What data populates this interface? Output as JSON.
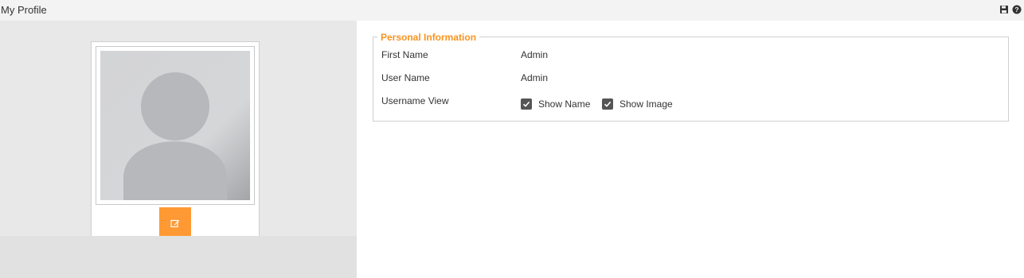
{
  "header": {
    "title": "My Profile",
    "icons": [
      "save-icon",
      "help-icon"
    ]
  },
  "profile_photo": {
    "edit_icon": "edit-icon",
    "placeholder_icon": "user-silhouette-icon"
  },
  "personal_information": {
    "legend": "Personal Information",
    "first_name": {
      "label": "First Name",
      "value": "Admin"
    },
    "user_name": {
      "label": "User Name",
      "value": "Admin"
    },
    "username_view": {
      "label": "Username View",
      "show_name": {
        "label": "Show Name",
        "checked": true
      },
      "show_image": {
        "label": "Show Image",
        "checked": true
      }
    }
  },
  "colors": {
    "accent": "#ff9933",
    "legend": "#f7931e",
    "checkbox": "#555555",
    "left_pane": "#e8e8e8"
  }
}
